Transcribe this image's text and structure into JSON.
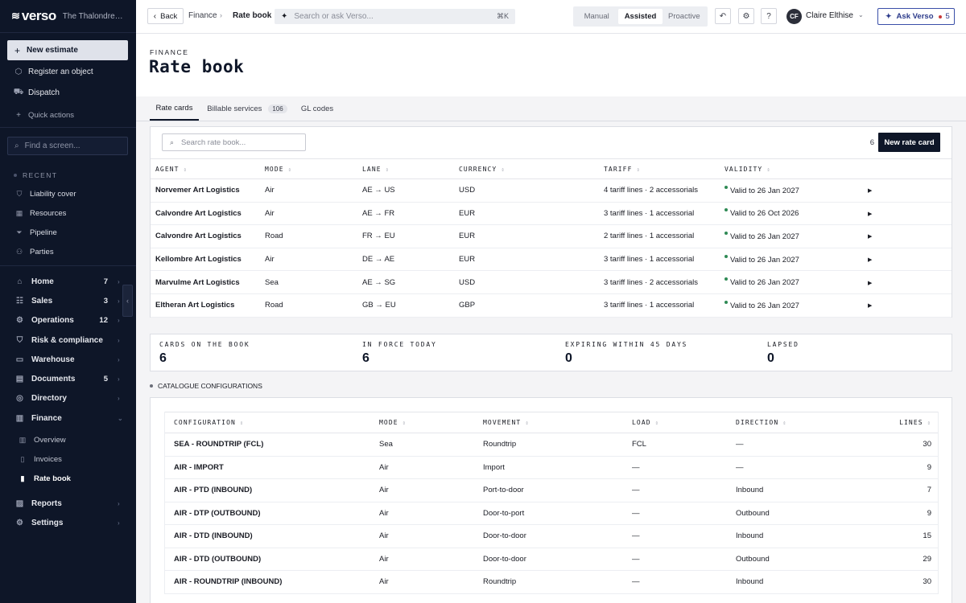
{
  "app": {
    "logo_glyph": "≋",
    "logo_text": "verso",
    "org_name": "The Thalondre Ar...",
    "user_initials": "CF",
    "user_name": "Claire Elthise"
  },
  "sidebar": {
    "new_estimate": "New estimate",
    "actions": [
      {
        "label": "Register an object",
        "icon": "cube-icon"
      },
      {
        "label": "Dispatch",
        "icon": "truck-icon"
      }
    ],
    "quick_actions": "Quick actions",
    "find_placeholder": "Find a screen...",
    "recent_label": "RECENT",
    "recent": [
      {
        "label": "Liability cover",
        "icon": "shield-icon"
      },
      {
        "label": "Resources",
        "icon": "grid-icon"
      },
      {
        "label": "Pipeline",
        "icon": "funnel-icon"
      },
      {
        "label": "Parties",
        "icon": "users-icon"
      }
    ],
    "nav": [
      {
        "label": "Home",
        "count": "7",
        "icon": "home-icon"
      },
      {
        "label": "Sales",
        "count": "3",
        "icon": "sales-icon"
      },
      {
        "label": "Operations",
        "count": "12",
        "icon": "operations-icon"
      },
      {
        "label": "Risk & compliance",
        "count": "",
        "icon": "shield-icon"
      },
      {
        "label": "Warehouse",
        "count": "",
        "icon": "warehouse-icon"
      },
      {
        "label": "Documents",
        "count": "5",
        "icon": "document-icon"
      },
      {
        "label": "Directory",
        "count": "",
        "icon": "directory-icon"
      },
      {
        "label": "Finance",
        "count": "",
        "icon": "finance-icon"
      }
    ],
    "finance_sub": [
      {
        "label": "Overview",
        "icon": "chart-icon"
      },
      {
        "label": "Invoices",
        "icon": "invoice-icon"
      },
      {
        "label": "Rate book",
        "icon": "book-icon"
      }
    ],
    "bottom_nav": [
      {
        "label": "Reports",
        "icon": "reports-icon"
      },
      {
        "label": "Settings",
        "icon": "gear-icon"
      }
    ]
  },
  "topbar": {
    "back": "Back",
    "crumb_parent": "Finance",
    "crumb_current": "Rate book",
    "search_placeholder": "Search or ask Verso...",
    "search_shortcut": "⌘K",
    "modes": [
      "Manual",
      "Assisted",
      "Proactive"
    ],
    "mode_selected": "Assisted",
    "ask_label": "Ask Verso",
    "ask_count": "5"
  },
  "page": {
    "eyebrow": "FINANCE",
    "title": "Rate book"
  },
  "tabs": [
    {
      "label": "Rate cards",
      "badge": ""
    },
    {
      "label": "Billable services",
      "badge": "106"
    },
    {
      "label": "GL codes",
      "badge": ""
    }
  ],
  "rate_cards": {
    "search_placeholder": "Search rate book...",
    "count": "6",
    "new_button": "New rate card",
    "columns": [
      "AGENT",
      "MODE",
      "LANE",
      "CURRENCY",
      "TARIFF",
      "VALIDITY"
    ],
    "rows": [
      {
        "agent": "Norvemer Art Logistics",
        "mode": "Air",
        "lane": "AE → US",
        "currency": "USD",
        "tariff": "4 tariff lines · 2 accessorials",
        "validity": "Valid to 26 Jan 2027"
      },
      {
        "agent": "Calvondre Art Logistics",
        "mode": "Air",
        "lane": "AE → FR",
        "currency": "EUR",
        "tariff": "3 tariff lines · 1 accessorial",
        "validity": "Valid to 26 Oct 2026"
      },
      {
        "agent": "Calvondre Art Logistics",
        "mode": "Road",
        "lane": "FR → EU",
        "currency": "EUR",
        "tariff": "2 tariff lines · 1 accessorial",
        "validity": "Valid to 26 Jan 2027"
      },
      {
        "agent": "Kellombre Art Logistics",
        "mode": "Air",
        "lane": "DE → AE",
        "currency": "EUR",
        "tariff": "3 tariff lines · 1 accessorial",
        "validity": "Valid to 26 Jan 2027"
      },
      {
        "agent": "Marvulme Art Logistics",
        "mode": "Sea",
        "lane": "AE → SG",
        "currency": "USD",
        "tariff": "3 tariff lines · 2 accessorials",
        "validity": "Valid to 26 Jan 2027"
      },
      {
        "agent": "Eltheran Art Logistics",
        "mode": "Road",
        "lane": "GB → EU",
        "currency": "GBP",
        "tariff": "3 tariff lines · 1 accessorial",
        "validity": "Valid to 26 Jan 2027"
      }
    ]
  },
  "stats": [
    {
      "label": "CARDS ON THE BOOK",
      "value": "6"
    },
    {
      "label": "IN FORCE TODAY",
      "value": "6"
    },
    {
      "label": "EXPIRING WITHIN 45 DAYS",
      "value": "0"
    },
    {
      "label": "LAPSED",
      "value": "0"
    }
  ],
  "catalogue": {
    "label": "CATALOGUE CONFIGURATIONS",
    "columns": [
      "CONFIGURATION",
      "MODE",
      "MOVEMENT",
      "LOAD",
      "DIRECTION",
      "LINES"
    ],
    "rows": [
      {
        "config": "SEA - ROUNDTRIP (FCL)",
        "mode": "Sea",
        "movement": "Roundtrip",
        "load": "FCL",
        "direction": "—",
        "lines": "30"
      },
      {
        "config": "AIR - IMPORT",
        "mode": "Air",
        "movement": "Import",
        "load": "—",
        "direction": "—",
        "lines": "9"
      },
      {
        "config": "AIR - PTD (INBOUND)",
        "mode": "Air",
        "movement": "Port-to-door",
        "load": "—",
        "direction": "Inbound",
        "lines": "7"
      },
      {
        "config": "AIR - DTP (OUTBOUND)",
        "mode": "Air",
        "movement": "Door-to-port",
        "load": "—",
        "direction": "Outbound",
        "lines": "9"
      },
      {
        "config": "AIR - DTD (INBOUND)",
        "mode": "Air",
        "movement": "Door-to-door",
        "load": "—",
        "direction": "Inbound",
        "lines": "15"
      },
      {
        "config": "AIR - DTD (OUTBOUND)",
        "mode": "Air",
        "movement": "Door-to-door",
        "load": "—",
        "direction": "Outbound",
        "lines": "29"
      },
      {
        "config": "AIR - ROUNDTRIP (INBOUND)",
        "mode": "Air",
        "movement": "Roundtrip",
        "load": "—",
        "direction": "Inbound",
        "lines": "30"
      }
    ]
  }
}
